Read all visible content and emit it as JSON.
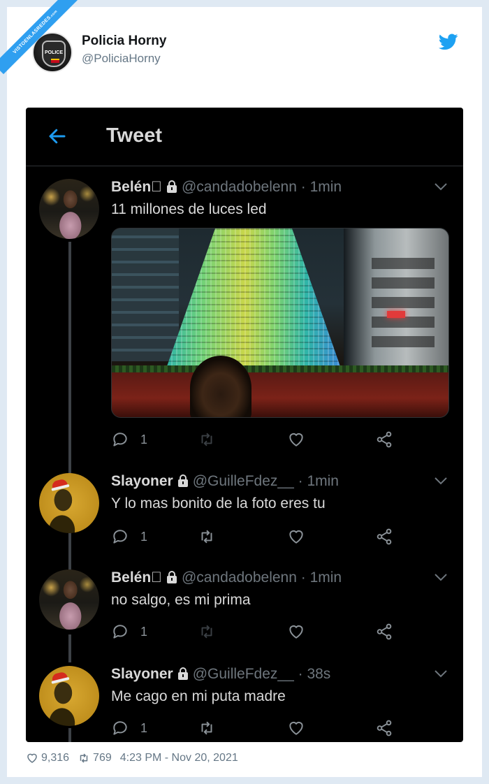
{
  "watermark": {
    "text": "VISTOENLASREDES",
    "suffix": ".com"
  },
  "embed": {
    "display_name": "Policia Horny",
    "handle": "@PoliciaHorny",
    "avatar_badge_text": "POLICE"
  },
  "screenshot": {
    "title": "Tweet",
    "tweets": [
      {
        "name": "Belén\u0000",
        "handle": "@candadobelenn",
        "time": "· 1min",
        "text": "11 millones de luces led",
        "replies": "1",
        "avatar": "belen"
      },
      {
        "name": "Slayoner",
        "handle": "@GuilleFdez__",
        "time": "· 1min",
        "text": "Y lo mas bonito de la foto eres tu",
        "replies": "1",
        "avatar": "slayoner"
      },
      {
        "name": "Belén\u0000",
        "handle": "@candadobelenn",
        "time": "· 1min",
        "text": "no salgo, es mi prima",
        "replies": "1",
        "avatar": "belen"
      },
      {
        "name": "Slayoner",
        "handle": "@GuilleFdez__",
        "time": "· 38s",
        "text": "Me cago en mi puta madre",
        "replies": "1",
        "avatar": "slayoner"
      }
    ]
  },
  "footer": {
    "likes": "9,316",
    "retweets": "769",
    "timestamp": "4:23 PM - Nov 20, 2021"
  },
  "colors": {
    "twitter_blue": "#1da1f2",
    "background": "#000000",
    "text": "#d9d9d9",
    "muted": "#6e767d"
  },
  "icons": [
    "twitter-bird-icon",
    "back-arrow-icon",
    "lock-icon",
    "chevron-down-icon",
    "reply-icon",
    "retweet-icon",
    "like-icon",
    "share-icon"
  ]
}
